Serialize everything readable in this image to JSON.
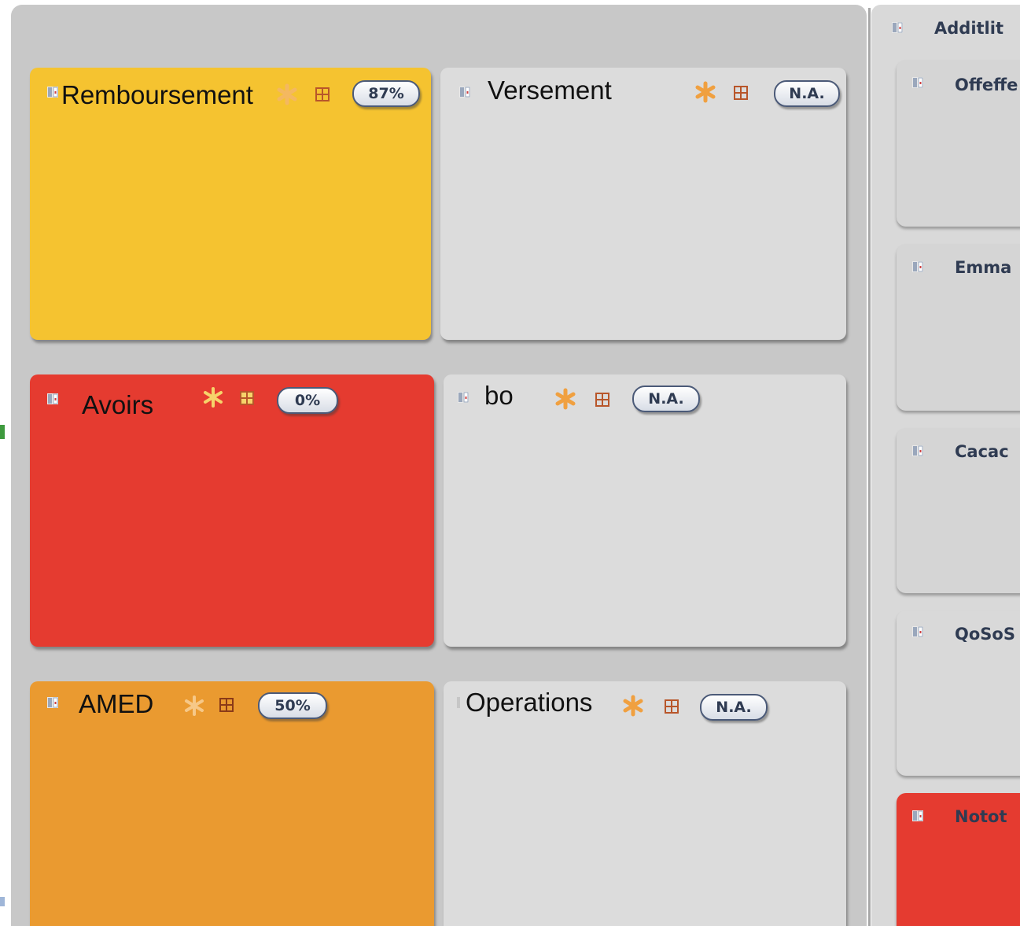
{
  "cards": [
    {
      "title": "Remboursement",
      "badge": "87%",
      "color": "#f5c330"
    },
    {
      "title": "Versement",
      "badge": "N.A.",
      "color": "#dcdcdc"
    },
    {
      "title": "Avoirs",
      "badge": "0%",
      "color": "#e53b30"
    },
    {
      "title": "bo",
      "badge": "N.A.",
      "color": "#dcdcdc"
    },
    {
      "title": "AMED",
      "badge": "50%",
      "color": "#ea9a30"
    },
    {
      "title": "Operations",
      "badge": "N.A.",
      "color": "#dcdcdc"
    }
  ],
  "side": {
    "header": "Additlit",
    "items": [
      {
        "title": "Offeffe",
        "color": "#d5d5d5"
      },
      {
        "title": "Emma",
        "color": "#d5d5d5"
      },
      {
        "title": "Cacac",
        "color": "#d5d5d5"
      },
      {
        "title": "QoSoS",
        "color": "#d9d9d9"
      },
      {
        "title": "Notot",
        "color": "#e53b30"
      }
    ]
  },
  "icons": {
    "book": "book-icon",
    "star": "asterisk-icon",
    "grid": "grid-icon"
  }
}
